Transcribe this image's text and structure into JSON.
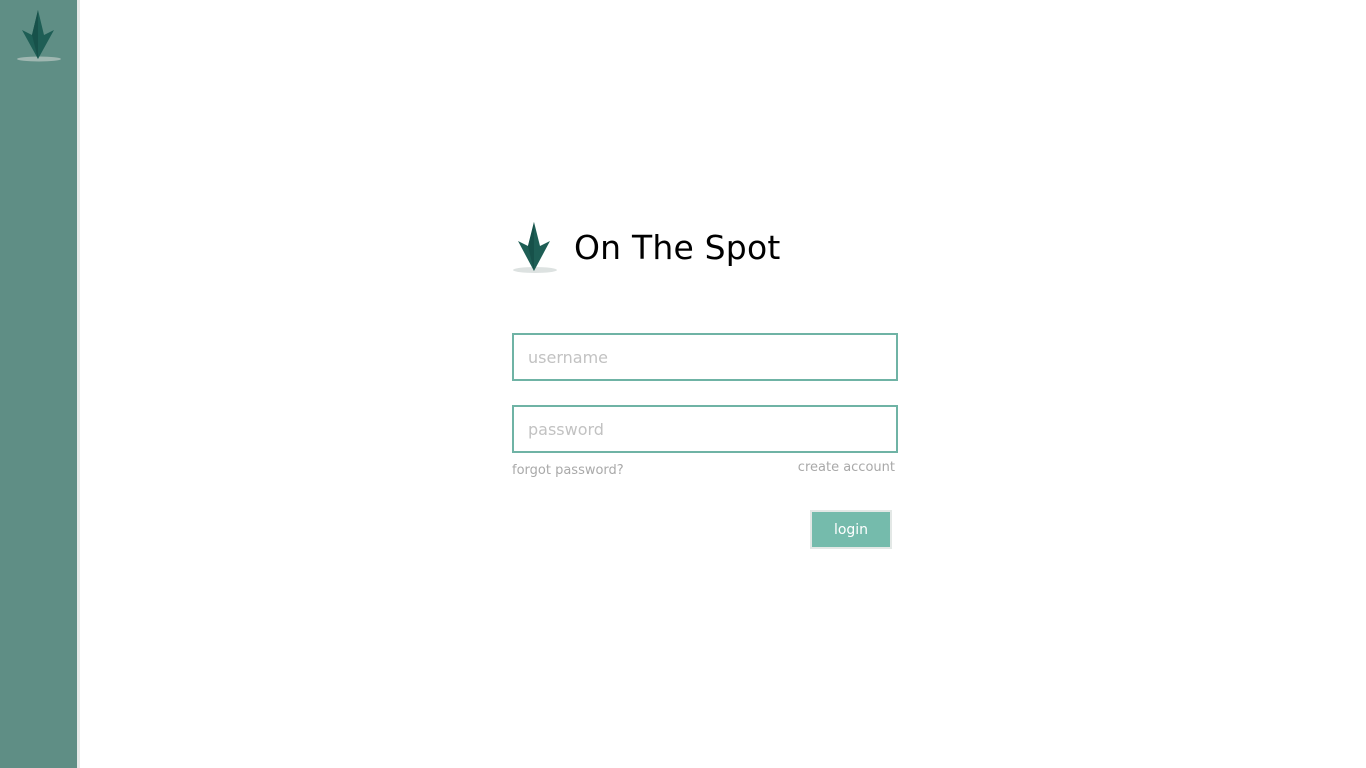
{
  "brand": {
    "title": "On The Spot",
    "logo_icon": "arrow-leaf-logo-icon",
    "accent_color": "#1e5e55",
    "sidebar_color": "#5f8e85"
  },
  "form": {
    "username_placeholder": "username",
    "username_value": "",
    "password_placeholder": "password",
    "password_value": "",
    "forgot_password_label": "forgot password?",
    "create_account_label": "create account",
    "login_label": "login",
    "field_border_color": "#6fb3a5",
    "button_color": "#75bbac"
  }
}
